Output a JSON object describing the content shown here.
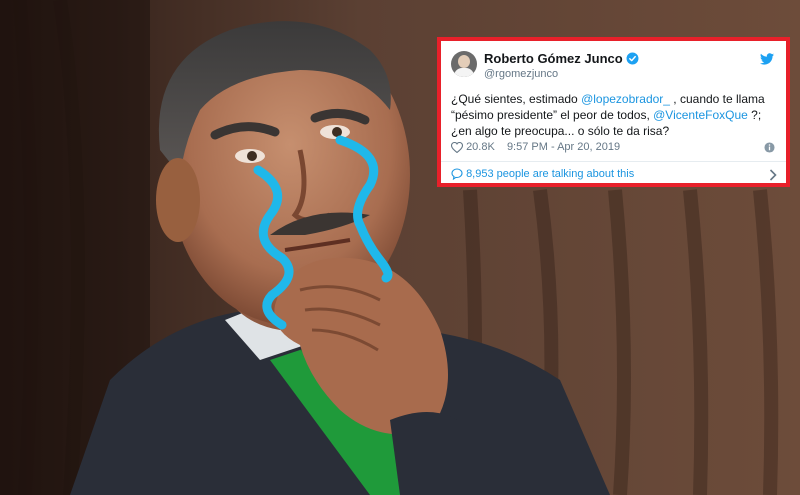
{
  "tweet": {
    "name": "Roberto Gómez Junco",
    "handle": "@rgomezjunco",
    "text_1": "¿Qué sientes, estimado ",
    "mention_1": "@lopezobrador_",
    "text_2": " , cuando te llama “pésimo presidente” el peor de todos, ",
    "mention_2": "@VicenteFoxQue",
    "text_3": " ?; ¿en algo te preocupa... o sólo te da risa?",
    "likes": "20.8K",
    "time": "9:57 PM - Apr 20, 2019",
    "talking": "8,953 people are talking about this",
    "icons": [
      "verified-icon",
      "twitter-bird-icon",
      "heart-icon",
      "info-icon",
      "comment-icon",
      "chevron-right-icon"
    ]
  },
  "colors": {
    "frame": "#e8202a",
    "link": "#1b95e0",
    "tears": "#1fb8ea",
    "suit": "#2b2f3a",
    "sash": "#1f9a3a"
  }
}
